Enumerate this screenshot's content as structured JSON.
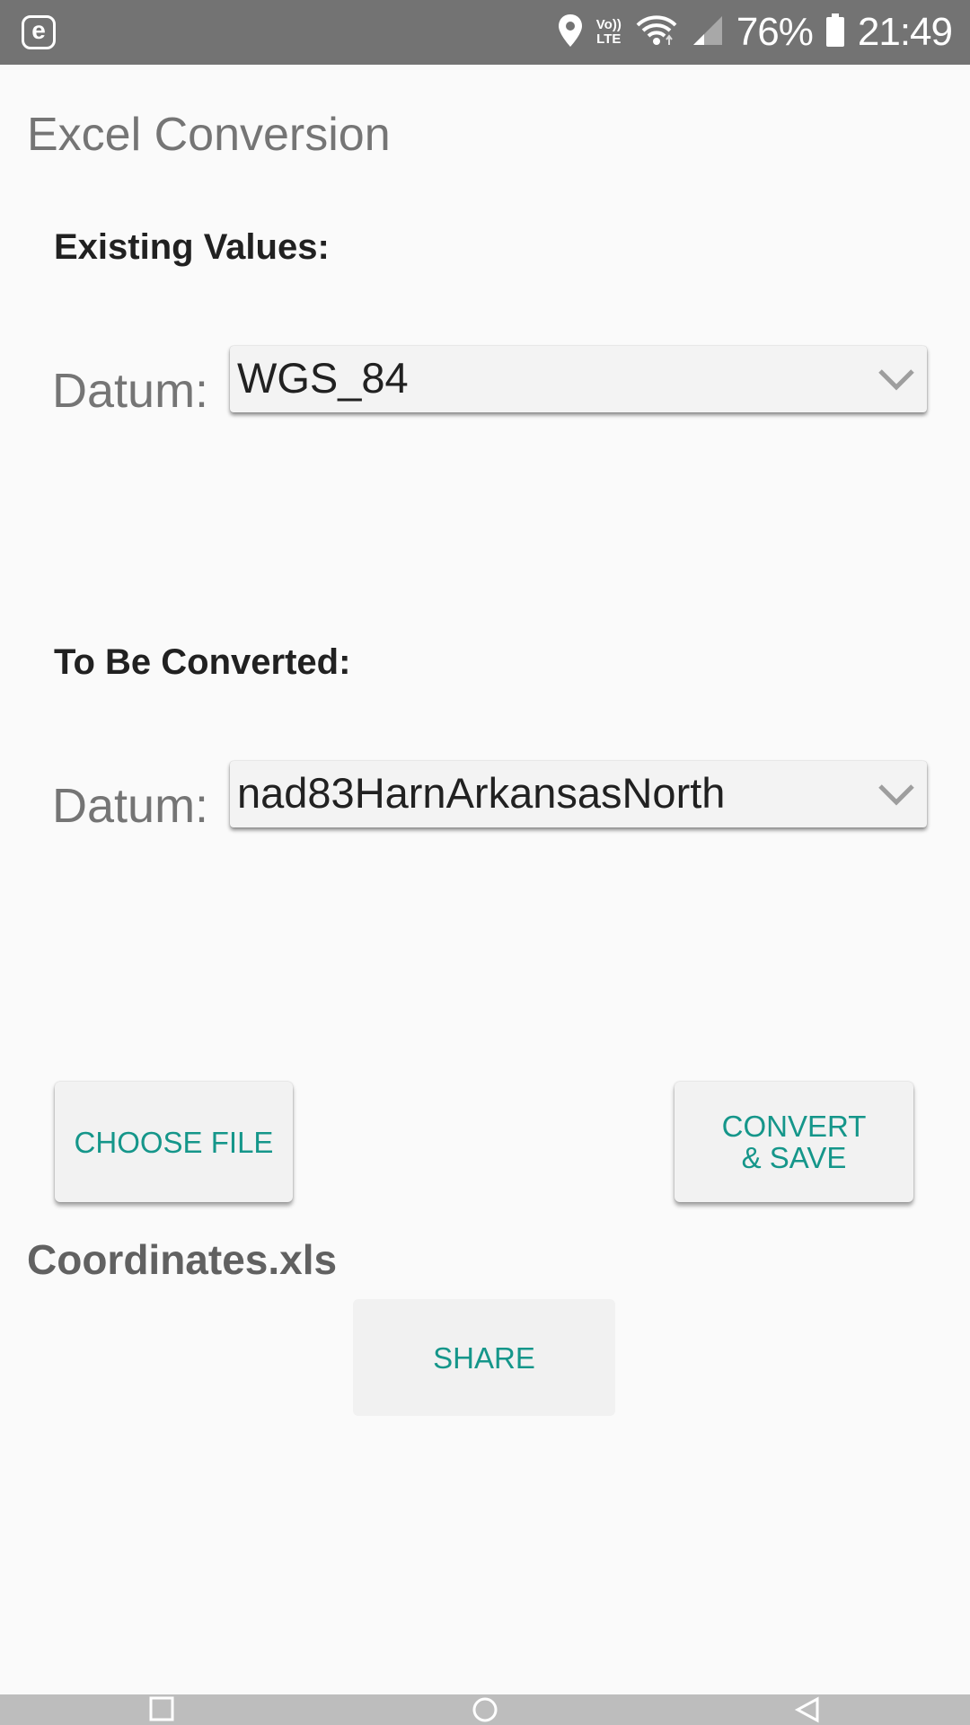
{
  "status_bar": {
    "app_icon_letter": "e",
    "lte_top": "Vo))",
    "lte_bottom": "LTE",
    "battery_percent": "76%",
    "time": "21:49",
    "icons": [
      "location-icon",
      "volte-icon",
      "wifi-icon",
      "signal-icon",
      "battery-icon"
    ]
  },
  "page": {
    "title": "Excel Conversion"
  },
  "existing": {
    "section_label": "Existing Values:",
    "datum_label": "Datum:",
    "datum_value": "WGS_84"
  },
  "converted": {
    "section_label": "To Be Converted:",
    "datum_label": "Datum:",
    "datum_value": "nad83HarnArkansasNorth"
  },
  "buttons": {
    "choose_file": "CHOOSE FILE",
    "convert_save": "CONVERT\n& SAVE",
    "share": "SHARE"
  },
  "file": {
    "name": "Coordinates.xls"
  },
  "colors": {
    "accent": "#15968a",
    "status_bar": "#737373",
    "background": "#fafafa"
  }
}
